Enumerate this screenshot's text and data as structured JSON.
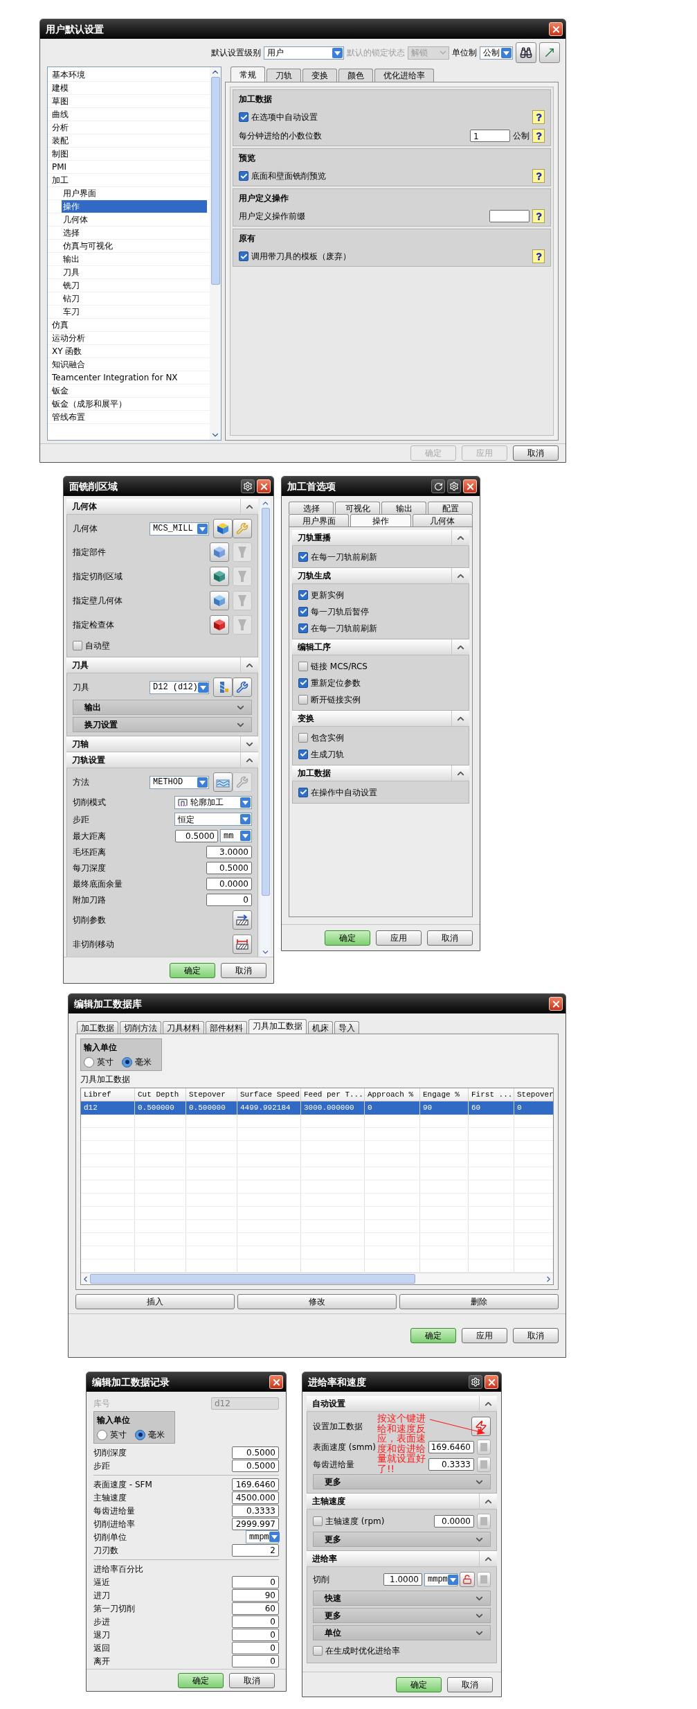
{
  "user_defaults": {
    "title": "用户默认设置",
    "level_label": "默认设置级别",
    "level_value": "用户",
    "lock_label": "默认的锁定状态",
    "lock_value": "解锁",
    "lock_disabled": true,
    "unit_label": "单位制",
    "unit_value": "公制",
    "tree": [
      {
        "label": "基本环境",
        "selected": false
      },
      {
        "label": "建模",
        "selected": false
      },
      {
        "label": "草图",
        "selected": false
      },
      {
        "label": "曲线",
        "selected": false
      },
      {
        "label": "分析",
        "selected": false
      },
      {
        "label": "装配",
        "selected": false
      },
      {
        "label": "制图",
        "selected": false
      },
      {
        "label": "PMI",
        "selected": false
      },
      {
        "label": "加工",
        "selected": false,
        "children": [
          {
            "label": "用户界面",
            "selected": false
          },
          {
            "label": "操作",
            "selected": true
          },
          {
            "label": "几何体",
            "selected": false
          },
          {
            "label": "选择",
            "selected": false
          },
          {
            "label": "仿真与可视化",
            "selected": false
          },
          {
            "label": "输出",
            "selected": false
          },
          {
            "label": "刀具",
            "selected": false
          },
          {
            "label": "铣刀",
            "selected": false
          },
          {
            "label": "钻刀",
            "selected": false
          },
          {
            "label": "车刀",
            "selected": false
          }
        ]
      },
      {
        "label": "仿真",
        "selected": false
      },
      {
        "label": "运动分析",
        "selected": false
      },
      {
        "label": "XY 函数",
        "selected": false
      },
      {
        "label": "知识融合",
        "selected": false
      },
      {
        "label": "Teamcenter Integration for NX",
        "selected": false
      },
      {
        "label": "钣金",
        "selected": false
      },
      {
        "label": "钣金（成形和展平）",
        "selected": false
      },
      {
        "label": "管线布置",
        "selected": false
      }
    ],
    "tabs": [
      {
        "label": "常规",
        "selected": true
      },
      {
        "label": "刀轨",
        "selected": false
      },
      {
        "label": "变换",
        "selected": false
      },
      {
        "label": "颜色",
        "selected": false
      },
      {
        "label": "优化进给率",
        "selected": false
      }
    ],
    "groups": [
      {
        "title": "加工数据",
        "rows": [
          {
            "kind": "checkbox",
            "label": "在选项中自动设置",
            "checked": true
          },
          {
            "kind": "field",
            "label": "每分钟进给的小数位数",
            "value": "1",
            "unit": "公制"
          }
        ]
      },
      {
        "title": "预览",
        "rows": [
          {
            "kind": "checkbox",
            "label": "底面和壁面铣削预览",
            "checked": true
          }
        ]
      },
      {
        "title": "用户定义操作",
        "rows": [
          {
            "kind": "field",
            "label": "用户定义操作前缀"
          }
        ]
      },
      {
        "title": "原有",
        "rows": [
          {
            "kind": "checkbox",
            "label": "调用带刀具的模板（废弃）",
            "checked": true
          }
        ]
      }
    ],
    "buttons": [
      {
        "label": "确定",
        "disabled": true
      },
      {
        "label": "应用",
        "disabled": true
      },
      {
        "label": "取消",
        "disabled": false
      }
    ]
  },
  "face_milling": {
    "title": "面铣削区域",
    "sections": [
      {
        "title": "几何体",
        "expanded": true,
        "rows": [
          {
            "kind": "select",
            "label": "几何体",
            "value": "MCS_MILL"
          },
          {
            "kind": "pick",
            "label": "指定部件"
          },
          {
            "kind": "pick",
            "label": "指定切削区域"
          },
          {
            "kind": "pick",
            "label": "指定壁几何体"
          },
          {
            "kind": "pick",
            "label": "指定检查体"
          },
          {
            "kind": "checkbox",
            "label": "自动壁",
            "checked": false
          }
        ]
      },
      {
        "title": "刀具",
        "expanded": true,
        "rows": [
          {
            "kind": "select",
            "label": "刀具",
            "value": "D12 (d12)"
          },
          {
            "kind": "sub",
            "title": "输出",
            "expanded": false
          },
          {
            "kind": "sub",
            "title": "换刀设置",
            "expanded": false
          }
        ]
      },
      {
        "title": "刀轴",
        "expanded": false
      },
      {
        "title": "刀轨设置",
        "expanded": true,
        "rows": [
          {
            "kind": "select",
            "label": "方法",
            "value": "METHOD"
          },
          {
            "kind": "mode",
            "label": "切削模式",
            "value": "轮廓加工"
          },
          {
            "kind": "wide_select",
            "label": "步距",
            "value": "恒定"
          },
          {
            "kind": "distance",
            "label": "最大距离",
            "value": "0.5000",
            "unit": "mm"
          },
          {
            "kind": "number",
            "label": "毛坯距离",
            "value": "3.0000"
          },
          {
            "kind": "number",
            "label": "每刀深度",
            "value": "0.5000"
          },
          {
            "kind": "number",
            "label": "最终底面余量",
            "value": "0.0000"
          },
          {
            "kind": "number",
            "label": "附加刀路",
            "value": "0"
          },
          {
            "kind": "action",
            "label": "切削参数"
          },
          {
            "kind": "action",
            "label": "非切削移动"
          }
        ]
      }
    ],
    "buttons": [
      {
        "label": "确定",
        "primary": true
      },
      {
        "label": "取消",
        "primary": false
      }
    ]
  },
  "preferences": {
    "title": "加工首选项",
    "tab_rows": [
      [
        {
          "label": "选择",
          "selected": false
        },
        {
          "label": "可视化",
          "selected": false
        },
        {
          "label": "输出",
          "selected": false
        },
        {
          "label": "配置",
          "selected": false
        }
      ],
      [
        {
          "label": "用户界面",
          "selected": false
        },
        {
          "label": "操作",
          "selected": true
        },
        {
          "label": "几何体",
          "selected": false
        }
      ]
    ],
    "sections": [
      {
        "title": "刀轨重播",
        "expanded": true,
        "items": [
          {
            "label": "在每一刀轨前刷新",
            "checked": true
          }
        ]
      },
      {
        "title": "刀轨生成",
        "expanded": true,
        "items": [
          {
            "label": "更新实例",
            "checked": true
          },
          {
            "label": "每一刀轨后暂停",
            "checked": true
          },
          {
            "label": "在每一刀轨前刷新",
            "checked": true
          }
        ]
      },
      {
        "title": "编辑工序",
        "expanded": true,
        "items": [
          {
            "label": "链接 MCS/RCS",
            "checked": false
          },
          {
            "label": "重新定位参数",
            "checked": true
          },
          {
            "label": "断开链接实例",
            "checked": false
          }
        ]
      },
      {
        "title": "变换",
        "expanded": true,
        "items": [
          {
            "label": "包含实例",
            "checked": false
          },
          {
            "label": "生成刀轨",
            "checked": true
          }
        ]
      },
      {
        "title": "加工数据",
        "expanded": true,
        "items": [
          {
            "label": "在操作中自动设置",
            "checked": true
          }
        ]
      }
    ],
    "buttons": [
      {
        "label": "确定",
        "primary": true
      },
      {
        "label": "应用",
        "primary": false
      },
      {
        "label": "取消",
        "primary": false
      }
    ]
  },
  "database": {
    "title": "编辑加工数据库",
    "tabs": [
      {
        "label": "加工数据",
        "selected": false
      },
      {
        "label": "切削方法",
        "selected": false
      },
      {
        "label": "刀具材料",
        "selected": false
      },
      {
        "label": "部件材料",
        "selected": false
      },
      {
        "label": "刀具加工数据",
        "selected": true
      },
      {
        "label": "机床",
        "selected": false
      },
      {
        "label": "导入",
        "selected": false
      }
    ],
    "unit_group": {
      "title": "输入单位",
      "options": [
        {
          "label": "英寸",
          "selected": false
        },
        {
          "label": "毫米",
          "selected": true
        }
      ]
    },
    "table_label": "刀具加工数据",
    "table": {
      "columns": [
        "Libref",
        "Cut Depth",
        "Stepover",
        "Surface Speed",
        "Feed per T...",
        "Approach %",
        "Engage %",
        "First ...",
        "Stepover"
      ],
      "rows": [
        {
          "selected": true,
          "cells": [
            "d12",
            "0.500000",
            "0.500000",
            "4499.992184",
            "3000.000000",
            "0",
            "90",
            "60",
            "0"
          ]
        }
      ]
    },
    "actions": [
      "插入",
      "修改",
      "删除"
    ],
    "buttons": [
      {
        "label": "确定",
        "primary": true
      },
      {
        "label": "应用",
        "primary": false
      },
      {
        "label": "取消",
        "primary": false
      }
    ]
  },
  "record": {
    "title": "编辑加工数据记录",
    "library": {
      "label": "库号",
      "value": "d12",
      "disabled": true
    },
    "unit_group": {
      "title": "输入单位",
      "options": [
        {
          "label": "英寸",
          "selected": false
        },
        {
          "label": "毫米",
          "selected": true
        }
      ]
    },
    "field_groups": [
      {
        "fields": [
          {
            "kind": "number",
            "label": "切削深度",
            "value": "0.5000"
          },
          {
            "kind": "number",
            "label": "步距",
            "value": "0.5000"
          }
        ]
      },
      {
        "fields": [
          {
            "kind": "number",
            "label": "表面速度 - SFM",
            "value": "169.6460"
          },
          {
            "kind": "number",
            "label": "主轴速度",
            "value": "4500.000"
          },
          {
            "kind": "number",
            "label": "每齿进给量",
            "value": "0.3333"
          },
          {
            "kind": "number",
            "label": "切削进给率",
            "value": "2999.997"
          },
          {
            "kind": "select",
            "label": "切削单位",
            "value": "mmpm"
          },
          {
            "kind": "number",
            "label": "刀刃数",
            "value": "2"
          }
        ]
      },
      {
        "title": "进给率百分比",
        "fields": [
          {
            "kind": "number",
            "label": "逼近",
            "value": "0"
          },
          {
            "kind": "number",
            "label": "进刀",
            "value": "90"
          },
          {
            "kind": "number",
            "label": "第一刀切削",
            "value": "60"
          },
          {
            "kind": "number",
            "label": "步进",
            "value": "0"
          },
          {
            "kind": "number",
            "label": "退刀",
            "value": "0"
          },
          {
            "kind": "number",
            "label": "返回",
            "value": "0"
          },
          {
            "kind": "number",
            "label": "离开",
            "value": "0"
          }
        ]
      }
    ],
    "buttons": [
      {
        "label": "确定",
        "primary": true
      },
      {
        "label": "取消",
        "primary": false
      }
    ]
  },
  "feeds": {
    "title": "进给率和速度",
    "sections": [
      {
        "title": "自动设置",
        "expanded": true,
        "rows": [
          {
            "kind": "button",
            "label": "设置加工数据"
          },
          {
            "kind": "number",
            "label": "表面速度 (smm)",
            "value": "169.6460"
          },
          {
            "kind": "number",
            "label": "每齿进给量",
            "value": "0.3333"
          },
          {
            "kind": "sub",
            "title": "更多",
            "expanded": false
          }
        ]
      },
      {
        "title": "主轴速度",
        "expanded": true,
        "rows": [
          {
            "kind": "check_number",
            "label": "主轴速度 (rpm)",
            "checked": false,
            "value": "0.0000"
          },
          {
            "kind": "sub",
            "title": "更多",
            "expanded": false
          }
        ]
      },
      {
        "title": "进给率",
        "expanded": true,
        "rows": [
          {
            "kind": "feed",
            "label": "切削",
            "value": "1.0000",
            "unit": "mmpm"
          },
          {
            "kind": "sub",
            "title": "快速",
            "expanded": false
          },
          {
            "kind": "sub",
            "title": "更多",
            "expanded": false
          },
          {
            "kind": "sub",
            "title": "单位",
            "expanded": false
          },
          {
            "kind": "checkbox",
            "label": "在生成时优化进给率",
            "checked": false
          }
        ]
      }
    ],
    "annotation": "按这个键进给和速度反应，表面速度和齿进给量就设置好了!!",
    "buttons": [
      {
        "label": "确定",
        "primary": true
      },
      {
        "label": "取消",
        "primary": false
      }
    ]
  }
}
